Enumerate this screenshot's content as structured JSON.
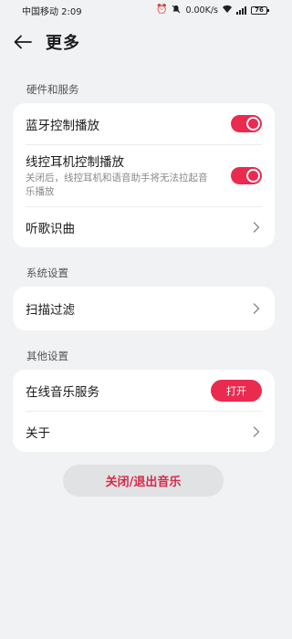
{
  "status_bar": {
    "carrier_time": "中国移动 2:09",
    "speed": "0.00K/s",
    "battery": "76",
    "icons": [
      "alarm-icon",
      "mute-icon",
      "wifi-icon",
      "signal-icon",
      "battery-icon"
    ]
  },
  "header": {
    "title": "更多",
    "back_icon": "arrow-left-icon"
  },
  "sections": {
    "hardware": {
      "label": "硬件和服务",
      "bluetooth": {
        "title": "蓝牙控制播放",
        "enabled": true
      },
      "wired": {
        "title": "线控耳机控制播放",
        "subtitle": "关闭后，线控耳机和语音助手将无法拉起音乐播放",
        "enabled": true
      },
      "song_id": {
        "title": "听歌识曲"
      }
    },
    "system": {
      "label": "系统设置",
      "scan_filter": {
        "title": "扫描过滤"
      }
    },
    "other": {
      "label": "其他设置",
      "online": {
        "title": "在线音乐服务",
        "button": "打开"
      },
      "about": {
        "title": "关于"
      }
    }
  },
  "exit_button": "关闭/退出音乐",
  "colors": {
    "accent": "#ea2a4f",
    "exit_text": "#d6294a",
    "background": "#f1f2f4",
    "card": "#ffffff"
  }
}
